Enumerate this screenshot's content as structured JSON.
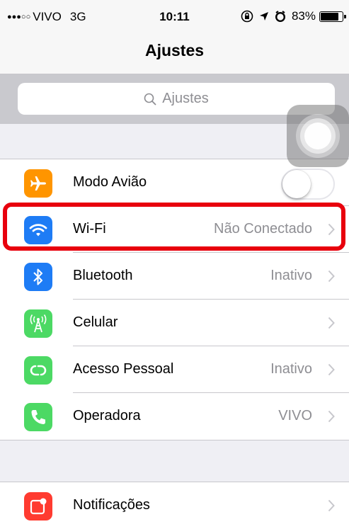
{
  "status_bar": {
    "signal_dots": "●●●○○",
    "carrier": "VIVO",
    "network": "3G",
    "time": "10:11",
    "battery_percent": "83%",
    "battery_level": 0.83,
    "icons": [
      "rotation-lock-icon",
      "location-arrow-icon",
      "alarm-icon",
      "battery-icon"
    ]
  },
  "nav": {
    "title": "Ajustes"
  },
  "search": {
    "placeholder": "Ajustes"
  },
  "group1": {
    "items": [
      {
        "label": "Modo Avião",
        "value": "",
        "icon": "airplane-icon",
        "color": "#ff9500",
        "toggle": false
      },
      {
        "label": "Wi-Fi",
        "value": "Não Conectado",
        "icon": "wifi-icon",
        "color": "#1e7cf5"
      },
      {
        "label": "Bluetooth",
        "value": "Inativo",
        "icon": "bluetooth-icon",
        "color": "#1e7cf5"
      },
      {
        "label": "Celular",
        "value": "",
        "icon": "cellular-antenna-icon",
        "color": "#4cd964"
      },
      {
        "label": "Acesso Pessoal",
        "value": "Inativo",
        "icon": "personal-hotspot-icon",
        "color": "#4cd964"
      },
      {
        "label": "Operadora",
        "value": "VIVO",
        "icon": "phone-icon",
        "color": "#4cd964"
      }
    ]
  },
  "group2": {
    "items": [
      {
        "label": "Notificações",
        "value": "",
        "icon": "notifications-icon",
        "color": "#ff3b30"
      }
    ]
  },
  "colors": {
    "highlight": "#e8000d",
    "accent": "#1e7cf5",
    "background": "#efeff4"
  }
}
